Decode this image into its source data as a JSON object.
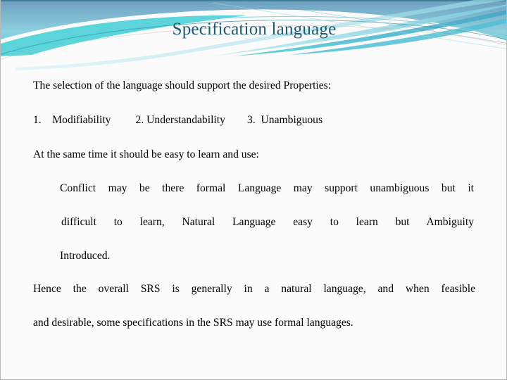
{
  "slide": {
    "title": "Specification language",
    "theme": {
      "title_color": "#1c5a73",
      "body_color": "#000000",
      "background_color": "#fbfbfb",
      "accent_cyan": "#2fd0d8",
      "accent_teal": "#4bb8cc",
      "accent_dark_teal": "#2d7f94",
      "accent_light": "#bfe9ef",
      "header_gradient_from": "#6f9fc0",
      "header_gradient_to": "#8fd6e2"
    },
    "body": {
      "intro": "The selection of the language should support the desired Properties:",
      "properties_line": "1.    Modifiability         2. Understandability        3.  Unambiguous",
      "properties": [
        {
          "number": "1.",
          "label": "Modifiability"
        },
        {
          "number": "2.",
          "label": "Understandability"
        },
        {
          "number": "3.",
          "label": "Unambiguous"
        }
      ],
      "same_time": "At the same time it should be easy to learn and use:",
      "conflict_line_1": "Conflict may be there formal Language may support unambiguous but it",
      "conflict_line_2": "difficult to learn, Natural Language easy to learn but Ambiguity",
      "conflict_line_3": "Introduced.",
      "hence_line_1": "Hence the overall SRS is generally in a natural language, and when feasible",
      "hence_line_2": "and desirable, some specifications in the SRS may use formal languages."
    }
  }
}
